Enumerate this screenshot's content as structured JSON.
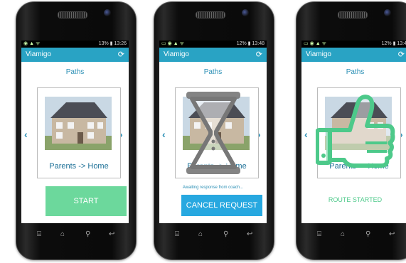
{
  "phones": [
    {
      "status": {
        "right": "13% ▮ 13:26"
      },
      "app_title": "Viamigo",
      "section_title": "Paths",
      "route_label": "Parents -> Home",
      "start_label": "START"
    },
    {
      "status": {
        "right": "12% ▮ 13:48"
      },
      "app_title": "Viamigo",
      "section_title": "Paths",
      "route_label": "Parents -> Home",
      "awaiting_text": "Awaiting response from coach...",
      "cancel_label": "CANCEL REQUEST"
    },
    {
      "status": {
        "right": "12% ▮ 13:4"
      },
      "app_title": "Viamigo",
      "section_title": "Paths",
      "route_label": "Parents -> Home",
      "route_started": "ROUTE STARTED"
    }
  ],
  "icons": {
    "sync": "sync-icon",
    "prev": "chevron-left-icon",
    "next": "chevron-right-icon",
    "hourglass": "hourglass-icon",
    "thumbs_up": "thumbs-up-icon"
  },
  "colors": {
    "app_bar": "#29a3c4",
    "start_button": "#6cd89c",
    "cancel_button": "#27a8e0",
    "route_started": "#4dc98a",
    "hourglass": "#777777",
    "thumb": "#4dc98a"
  }
}
